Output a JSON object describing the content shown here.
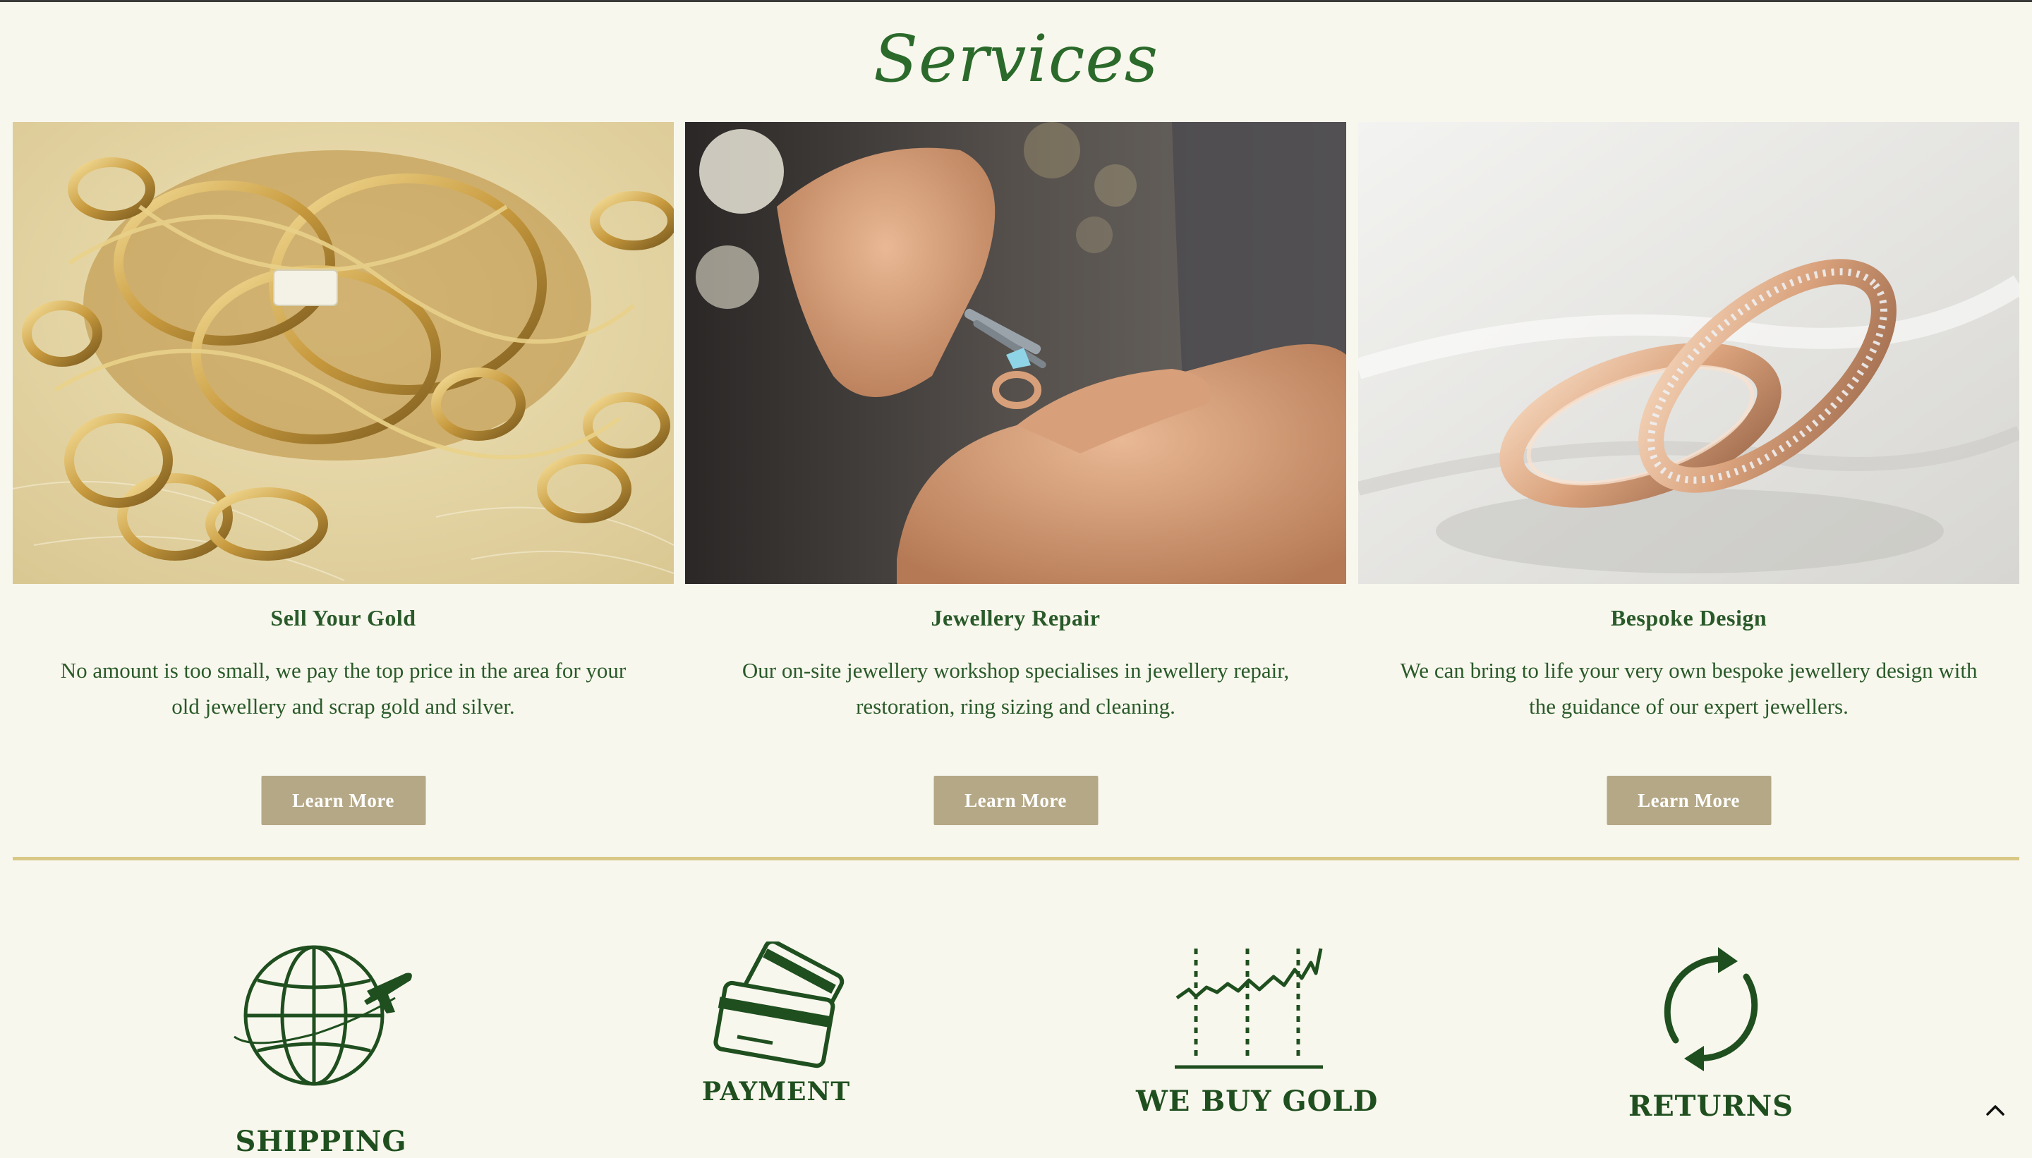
{
  "section": {
    "title": "Services"
  },
  "cards": [
    {
      "image_alt": "Pile of gold rings and chains",
      "title": "Sell Your Gold",
      "text": "No amount is too small, we pay the top price in the area for your old jewellery and scrap gold and silver.",
      "button": "Learn More"
    },
    {
      "image_alt": "Jeweller repairing a ring with tweezers",
      "title": "Jewellery Repair",
      "text": "Our on-site jewellery workshop specialises in jewellery repair, restoration,  ring sizing and cleaning.",
      "button": "Learn More"
    },
    {
      "image_alt": "Two interlocking rose gold wedding rings",
      "title": "Bespoke Design",
      "text": "We can bring to life your very own bespoke jewellery design with the guidance of our expert jewellers.",
      "button": "Learn More"
    }
  ],
  "features": [
    {
      "icon": "globe-plane-icon",
      "label": "SHIPPING"
    },
    {
      "icon": "credit-cards-icon",
      "label": "PAYMENT"
    },
    {
      "icon": "rising-chart-icon",
      "label": "WE BUY GOLD"
    },
    {
      "icon": "refresh-arrows-icon",
      "label": "RETURNS"
    }
  ],
  "colors": {
    "background": "#f8f7ed",
    "brand_green": "#1f4f1f",
    "button_bg": "#b5a886",
    "divider": "#d9c987"
  },
  "scroll_top": {
    "icon": "chevron-up-icon"
  }
}
